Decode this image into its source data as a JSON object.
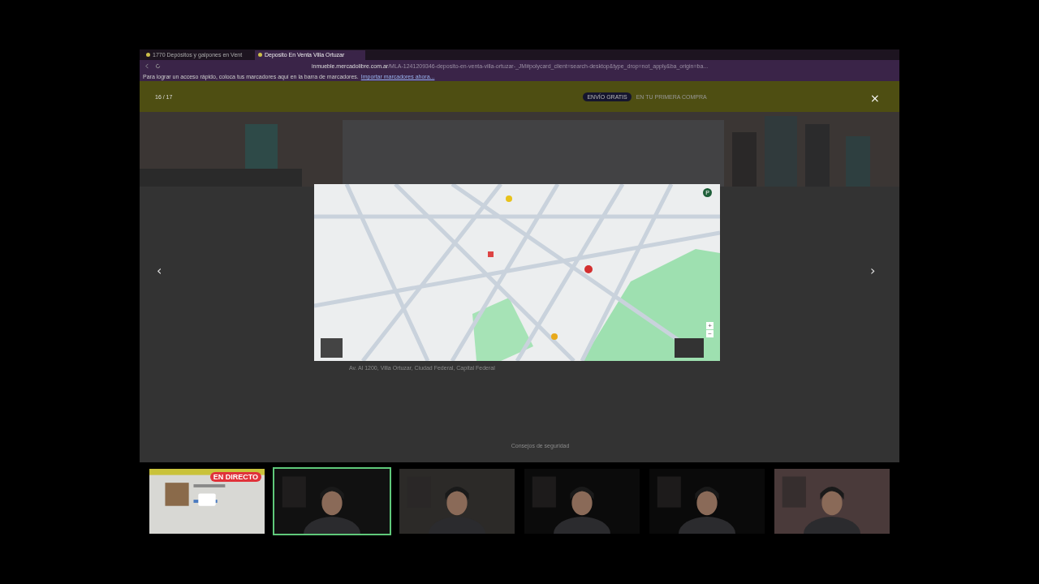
{
  "browser": {
    "tabs": [
      {
        "label": "1770 Depósitos y galpones en Vent",
        "selected": false
      },
      {
        "label": "Deposito En Venta Villa Ortuzar",
        "selected": true
      }
    ],
    "address": {
      "domain": "inmueble.mercadolibre.com.ar",
      "path": "/MLA-1241209346-deposito-en-venta-villa-ortuzar-_JM#polycard_client=search-desktop&type_drop=not_apply&ba_origin=ba..."
    },
    "bookmarks_hint": {
      "text": "Para lograr un acceso rápido, coloca tus marcadores aquí en la barra de marcadores.",
      "link": "Importar marcadores ahora..."
    }
  },
  "page": {
    "banner": {
      "badge": "ENVÍO GRATIS",
      "note": "EN TU PRIMERA COMPRA"
    },
    "address_line": "Av. Al 1200, Villa Ortuzar, Ciudad Federal, Capital Federal",
    "side_heading": "Consejos de seguridad"
  },
  "viewer": {
    "counter": "16 / 17",
    "close": "×",
    "prev": "‹",
    "next": "›",
    "map": {
      "avatar": "P",
      "zoom_in": "+",
      "zoom_out": "−"
    }
  },
  "call": {
    "participants": [
      {
        "kind": "screen",
        "selected": false,
        "live": true,
        "badge": "EN DIRECTO"
      },
      {
        "kind": "camera",
        "selected": true,
        "live": false
      },
      {
        "kind": "camera",
        "selected": false,
        "live": false
      },
      {
        "kind": "camera",
        "selected": false,
        "live": false
      },
      {
        "kind": "camera",
        "selected": false,
        "live": false
      },
      {
        "kind": "camera",
        "selected": false,
        "live": false
      }
    ]
  }
}
